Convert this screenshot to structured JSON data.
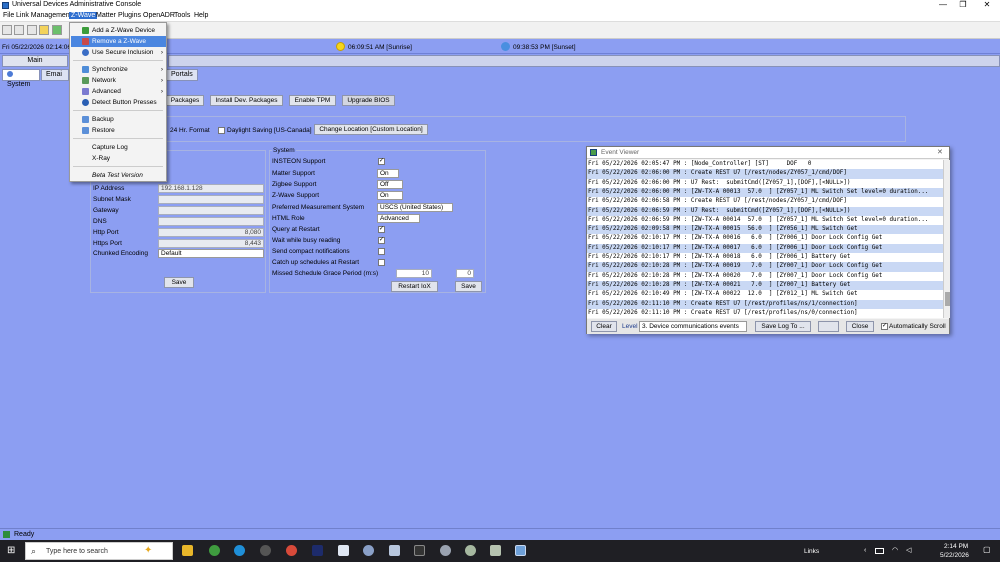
{
  "window": {
    "title": "Universal Devices Administrative Console",
    "minimize": "—",
    "maximize": "❐",
    "close": "✕"
  },
  "menubar": {
    "items": [
      "File",
      "Link Management",
      "Z-Wave",
      "Matter",
      "Plugins",
      "OpenADR",
      "Tools",
      "Help"
    ],
    "active": "Z-Wave"
  },
  "sunbar": {
    "date": "Fri 05/22/2026 02:14:06",
    "sunrise": "06:09:51 AM [Sunrise]",
    "sunset": "09:38:53 PM [Sunset]"
  },
  "tabs": {
    "main": "Main"
  },
  "subtabs": [
    "System",
    "Emai",
    "Portals"
  ],
  "toolbar_buttons": {
    "packages": "Packages",
    "install_dev": "Install Dev. Packages",
    "enable_tpm": "Enable TPM",
    "upgrade_bios": "Upgrade BIOS"
  },
  "time_settings": {
    "hr24": "24 Hr. Format",
    "daylight": "Daylight Saving [US-Canada]",
    "change_location": "Change Location [Custom Location]"
  },
  "network": {
    "labels": [
      "IP Address",
      "Subnet Mask",
      "Gateway",
      "DNS",
      "Http Port",
      "Https Port",
      "Chunked Encoding"
    ],
    "ip": "192.168.1.128",
    "http_port": "8,080",
    "https_port": "8,443",
    "chunked": "Default",
    "save": "Save"
  },
  "system": {
    "title": "System",
    "labels": [
      "INSTEON Support",
      "Matter Support",
      "Zigbee Support",
      "Z-Wave Support",
      "Preferred Measurement System",
      "HTML Role",
      "Query at Restart",
      "Wait while busy reading",
      "Send compact notifications",
      "Catch up schedules at Restart",
      "Missed Schedule Grace Period (m:s)"
    ],
    "matter": "On",
    "zigbee": "Off",
    "zwave": "On",
    "measurement": "USCS (United States)",
    "html_role": "Advanced",
    "grace_min": "10",
    "grace_sec": "0",
    "restart": "Restart IoX",
    "save": "Save"
  },
  "dropdown": {
    "items": [
      "Add a Z-Wave Device",
      "Remove a Z-Wave Device",
      "Use Secure Inclusion",
      "Synchronize",
      "Network",
      "Advanced",
      "Detect Button Presses",
      "Backup",
      "Restore",
      "Capture Log",
      "X-Ray",
      "Beta Test Version"
    ],
    "highlighted": "Remove a Z-Wave Device"
  },
  "event_viewer": {
    "title": "Event Viewer",
    "log": [
      "Fri 05/22/2026 02:05:47 PM : [Node_Controller] [ST]     DOF   0",
      "Fri 05/22/2026 02:06:00 PM : Create REST U7 [/rest/nodes/ZY057_1/cmd/DOF]",
      "Fri 05/22/2026 02:06:00 PM : U7 Rest:  submitCmd([ZY057_1],[DOF],[<NULL>])",
      "Fri 05/22/2026 02:06:00 PM : [ZW-TX-A 00013  57.0  ] [ZY057_1] ML Switch Set level=0 duration...",
      "Fri 05/22/2026 02:06:58 PM : Create REST U7 [/rest/nodes/ZY057_1/cmd/DOF]",
      "Fri 05/22/2026 02:06:59 PM : U7 Rest:  submitCmd([ZY057_1],[DOF],[<NULL>])",
      "Fri 05/22/2026 02:06:59 PM : [ZW-TX-A 00014  57.0  ] [ZY057_1] ML Switch Set level=0 duration...",
      "Fri 05/22/2026 02:09:58 PM : [ZW-TX-A 00015  56.0  ] [ZY056_1] ML Switch Get",
      "Fri 05/22/2026 02:10:17 PM : [ZW-TX-A 00016   6.0  ] [ZY006_1] Door Lock Config Get",
      "Fri 05/22/2026 02:10:17 PM : [ZW-TX-A 00017   6.0  ] [ZY006_1] Door Lock Config Get",
      "Fri 05/22/2026 02:10:17 PM : [ZW-TX-A 00018   6.0  ] [ZY006_1] Battery Get",
      "Fri 05/22/2026 02:10:28 PM : [ZW-TX-A 00019   7.0  ] [ZY007_1] Door Lock Config Get",
      "Fri 05/22/2026 02:10:28 PM : [ZW-TX-A 00020   7.0  ] [ZY007_1] Door Lock Config Get",
      "Fri 05/22/2026 02:10:28 PM : [ZW-TX-A 00021   7.0  ] [ZY007_1] Battery Get",
      "Fri 05/22/2026 02:10:49 PM : [ZW-TX-A 00022  12.0  ] [ZY012_1] ML Switch Get",
      "Fri 05/22/2026 02:11:10 PM : Create REST U7 [/rest/profiles/ns/1/connection]",
      "Fri 05/22/2026 02:11:10 PM : Create REST U7 [/rest/profiles/ns/0/connection]"
    ],
    "clear": "Clear",
    "level_label": "Level",
    "level": "3. Device communications events",
    "save_log": "Save Log To ...",
    "close": "Close",
    "auto_scroll": "Automatically Scroll"
  },
  "status": {
    "text": "Ready"
  },
  "taskbar": {
    "search_placeholder": "Type here to search",
    "links": "Links",
    "time": "2:14 PM",
    "date": "5/22/2026"
  }
}
